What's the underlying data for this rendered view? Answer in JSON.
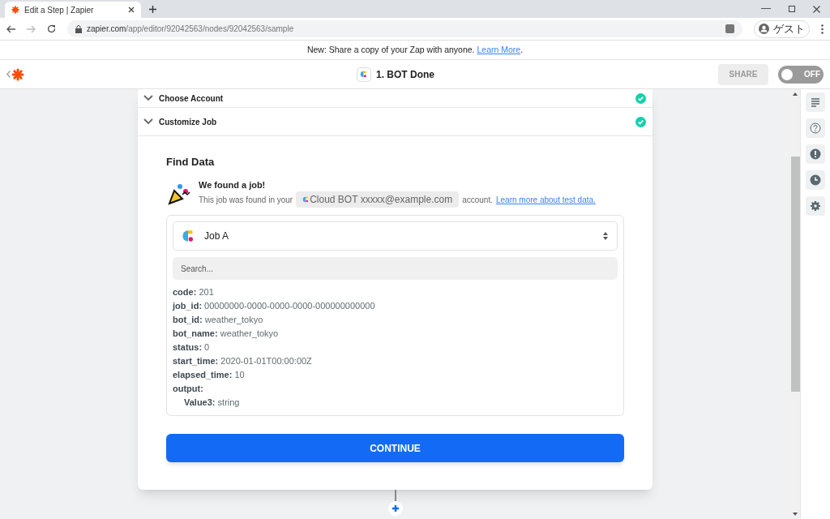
{
  "browser": {
    "tab_title": "Edit a Step | Zapier",
    "url_host": "zapier.com",
    "url_path": "/app/editor/92042563/nodes/92042563/sample",
    "profile": "ゲスト"
  },
  "banner": {
    "text": "New: Share a copy of your Zap with anyone.",
    "link": "Learn More",
    "suffix": "."
  },
  "header": {
    "title": "1. BOT Done",
    "share": "SHARE",
    "toggle": {
      "label": "OFF",
      "on": false
    }
  },
  "steps": [
    {
      "label": "Choose Account",
      "done": true
    },
    {
      "label": "Customize Job",
      "done": true
    }
  ],
  "find_data": {
    "title": "Find Data",
    "found_title": "We found a job!",
    "found_prefix": "This job was found in your",
    "account_chip": "Cloud BOT xxxxx@example.com",
    "found_suffix": "account.",
    "link": "Learn more about test data.",
    "select": "Job A",
    "search_placeholder": "Search...",
    "fields": [
      {
        "key": "code:",
        "value": "201"
      },
      {
        "key": "job_id:",
        "value": "00000000-0000-0000-0000-000000000000"
      },
      {
        "key": "bot_id:",
        "value": "weather_tokyo"
      },
      {
        "key": "bot_name:",
        "value": "weather_tokyo"
      },
      {
        "key": "status:",
        "value": "0"
      },
      {
        "key": "start_time:",
        "value": "2020-01-01T00:00:00Z"
      },
      {
        "key": "elapsed_time:",
        "value": "10"
      },
      {
        "key": "output:",
        "children": [
          {
            "key": "Value3:",
            "value": "string"
          }
        ]
      }
    ],
    "continue": "CONTINUE"
  }
}
